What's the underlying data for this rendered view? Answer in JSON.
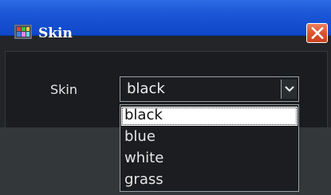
{
  "window": {
    "title": "Skin",
    "icon": "skin-app-icon",
    "close_icon": "close-icon",
    "accent_color": "#1a56d6",
    "close_color": "#e0532e"
  },
  "form": {
    "skin_label": "Skin",
    "skin_combo": {
      "value": "black",
      "expanded": true,
      "options": [
        "black",
        "blue",
        "white",
        "grass"
      ],
      "selected_option": "black"
    }
  }
}
